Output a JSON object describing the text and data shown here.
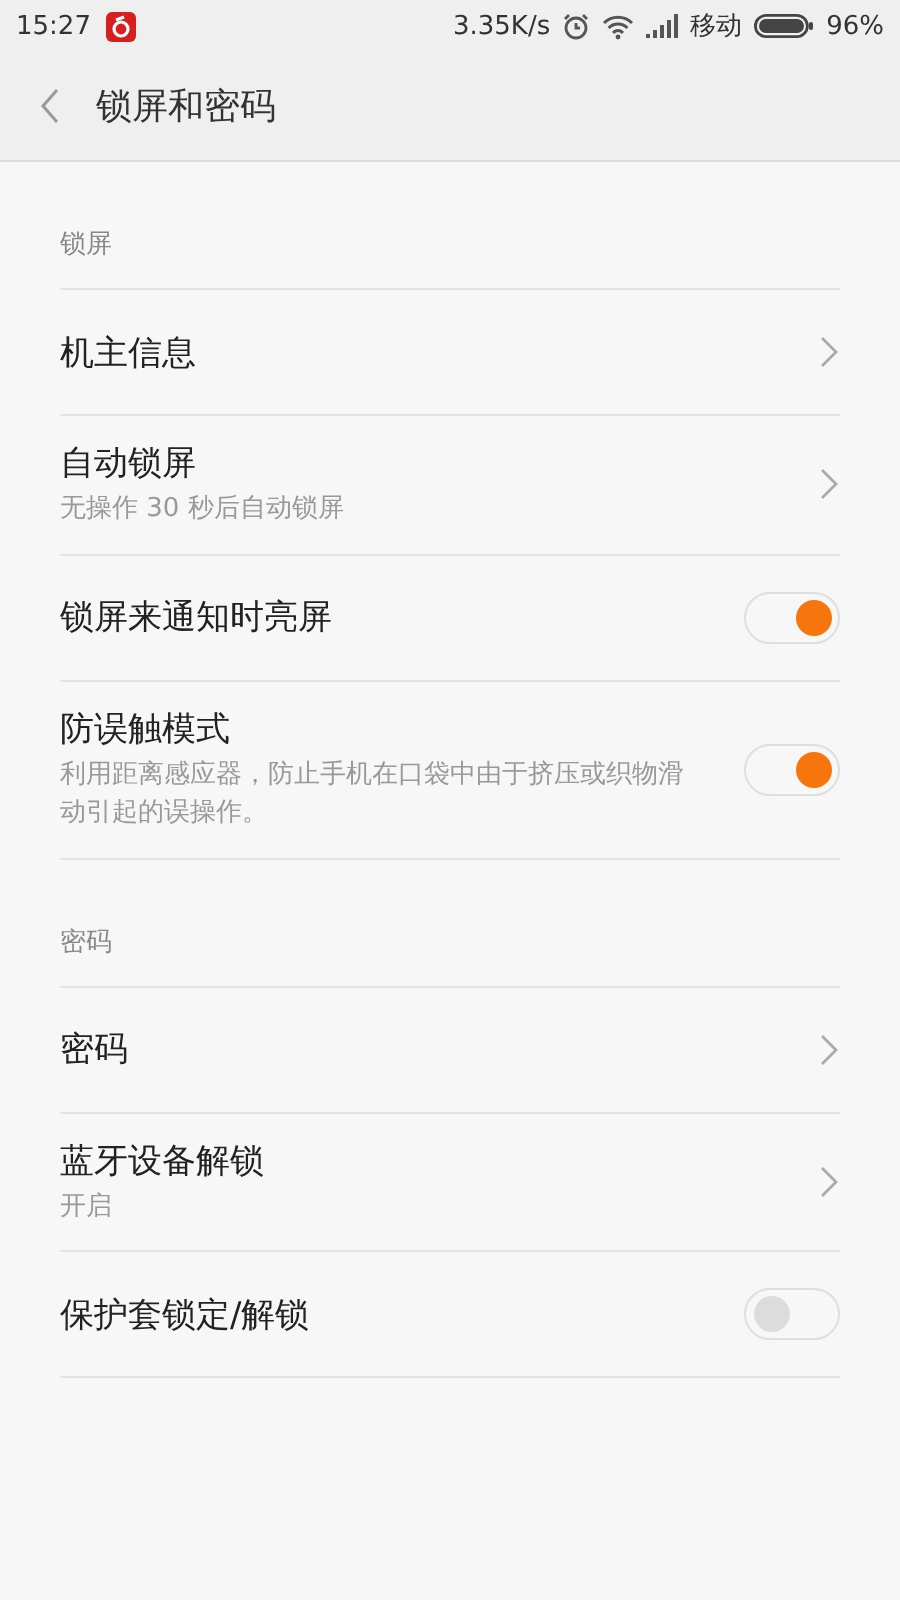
{
  "status_bar": {
    "time": "15:27",
    "speed": "3.35K/s",
    "carrier": "移动",
    "battery": "96%"
  },
  "header": {
    "title": "锁屏和密码"
  },
  "sections": [
    {
      "title": "锁屏",
      "items": [
        {
          "kind": "link",
          "label": "机主信息"
        },
        {
          "kind": "link",
          "label": "自动锁屏",
          "subtitle": "无操作 30 秒后自动锁屏"
        },
        {
          "kind": "toggle",
          "label": "锁屏来通知时亮屏",
          "on": true
        },
        {
          "kind": "toggle",
          "label": "防误触模式",
          "subtitle": "利用距离感应器，防止手机在口袋中由于挤压或织物滑动引起的误操作。",
          "on": true
        }
      ]
    },
    {
      "title": "密码",
      "items": [
        {
          "kind": "link",
          "label": "密码"
        },
        {
          "kind": "link",
          "label": "蓝牙设备解锁",
          "subtitle": "开启"
        },
        {
          "kind": "toggle",
          "label": "保护套锁定/解锁",
          "on": false
        }
      ]
    }
  ]
}
